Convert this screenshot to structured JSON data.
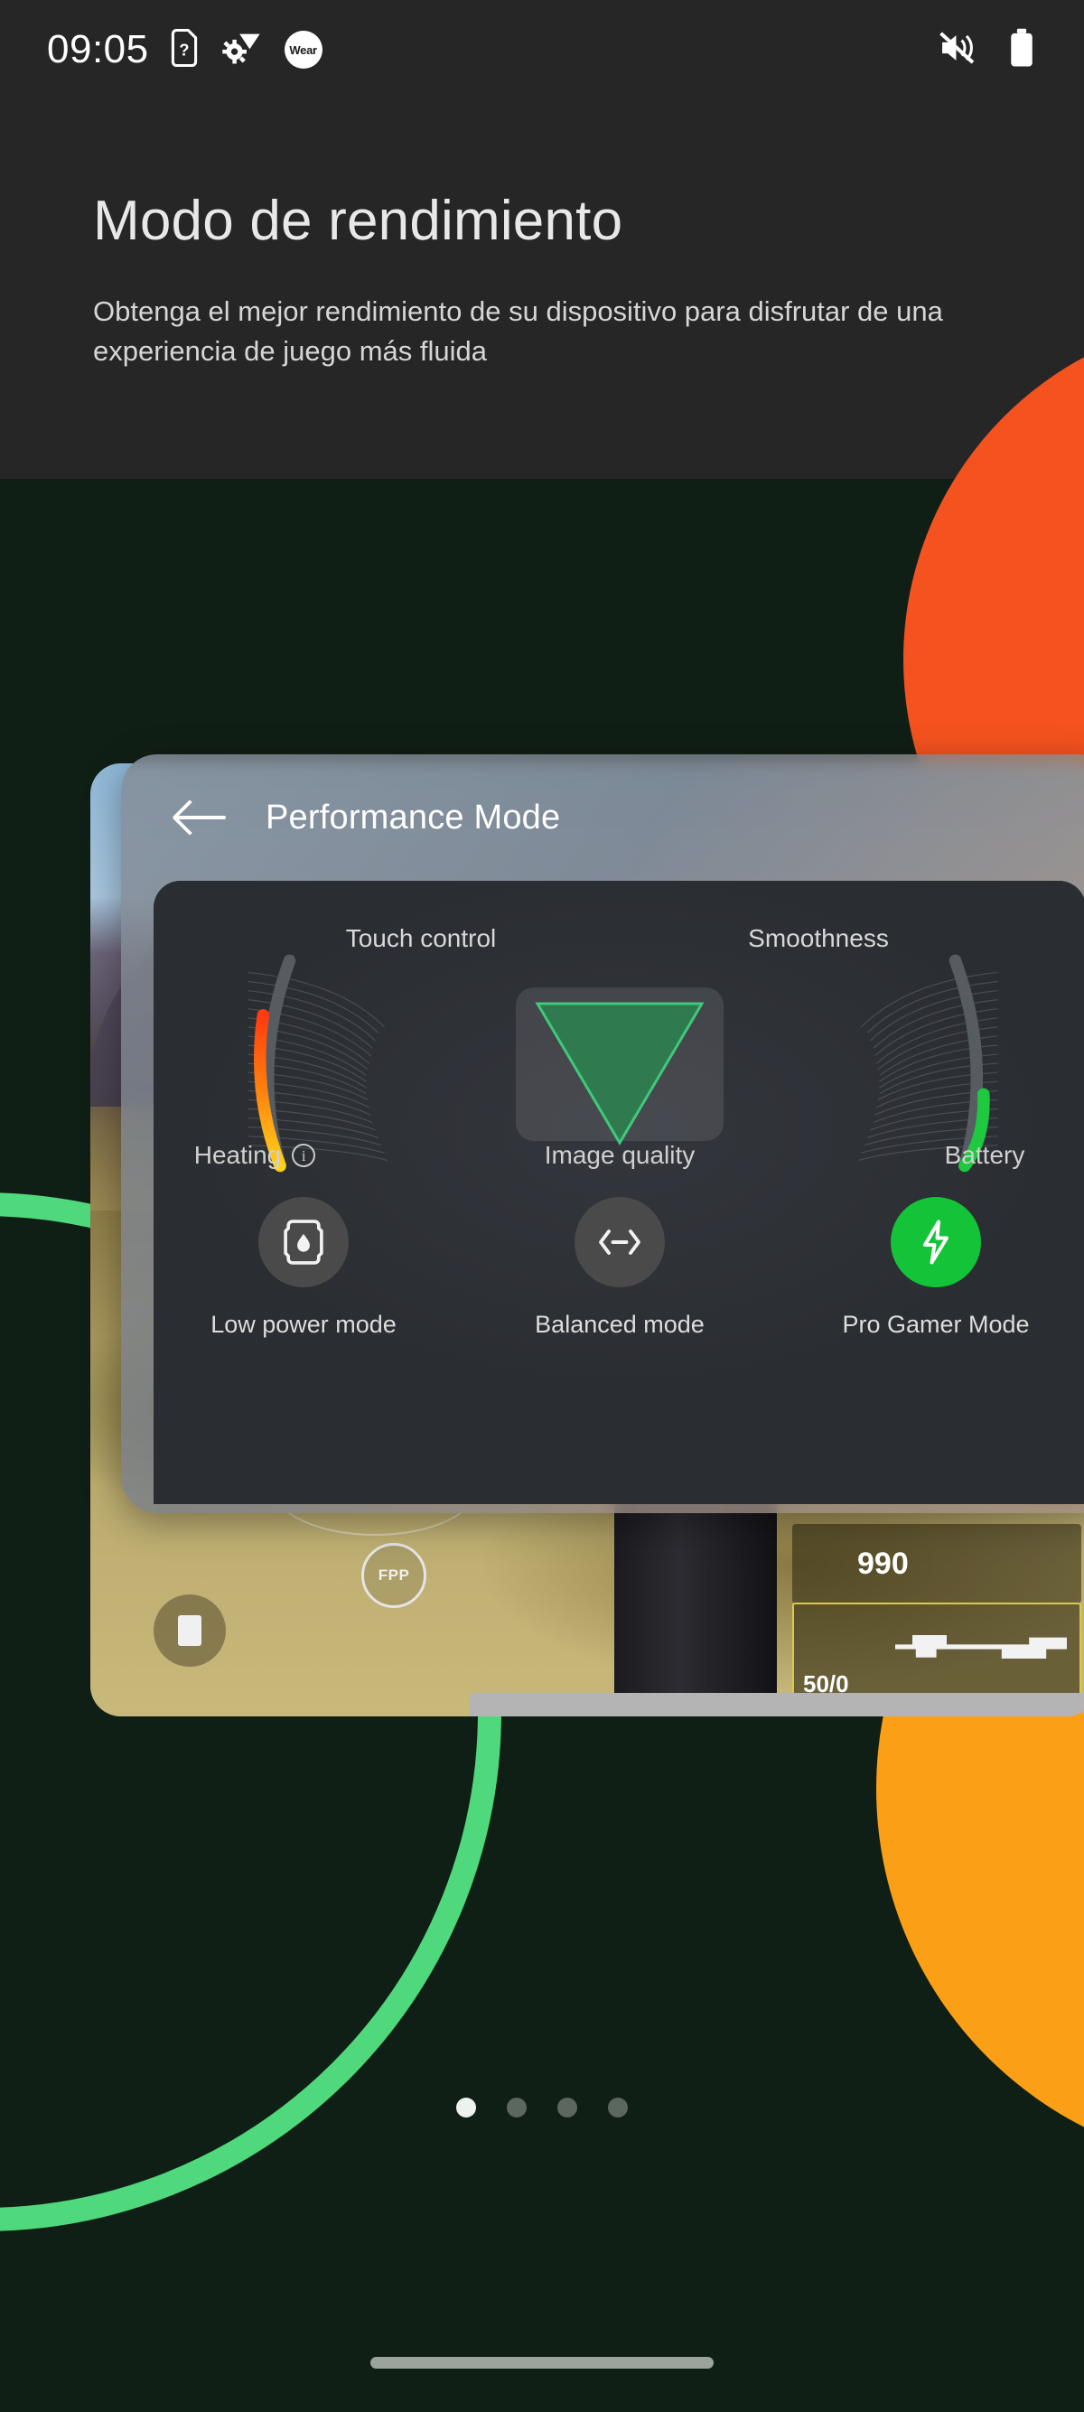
{
  "statusbar": {
    "time": "09:05",
    "icons": [
      {
        "name": "sim-card-question-icon",
        "label": "?"
      },
      {
        "name": "settings-wifi-icon",
        "label": ""
      },
      {
        "name": "wear-os-icon",
        "label": "Wear"
      }
    ],
    "right_icons": [
      {
        "name": "volume-mute-icon"
      },
      {
        "name": "battery-icon"
      }
    ]
  },
  "header": {
    "title": "Modo de rendimiento",
    "subtitle": "Obtenga el mejor rendimiento de su dispositivo para disfrutar de una experiencia de juego más fluida"
  },
  "card": {
    "modal": {
      "back_label": "back-arrow",
      "title": "Performance Mode",
      "gauges": {
        "top_labels": [
          "Touch control",
          "Smoothness"
        ],
        "bottom_labels": [
          "Heating",
          "Image quality",
          "Battery"
        ],
        "heating_info": "i",
        "heating_level_pct": 72,
        "battery_level_pct": 32,
        "image_quality_shape": "triangle-down"
      },
      "modes": [
        {
          "label": "Low power mode",
          "icon": "battery-saver-icon",
          "active": false
        },
        {
          "label": "Balanced mode",
          "icon": "balance-arrows-icon",
          "active": false
        },
        {
          "label": "Pro Gamer Mode",
          "icon": "lightning-bolt-icon",
          "active": true
        }
      ]
    },
    "game_hud": {
      "perspective": "FPP",
      "ammo_total": "990",
      "ammo_mag": "50",
      "ammo_spare": "0",
      "ammo_separator": "/"
    }
  },
  "pager": {
    "total": 4,
    "active_index": 0
  },
  "colors": {
    "accent_green": "#14c438",
    "orange_top": "#f4521f",
    "orange_bottom": "#fba016",
    "ring_green": "#4fd97c",
    "bg_dark": "#262626",
    "bg_green_dark": "#101f16"
  }
}
